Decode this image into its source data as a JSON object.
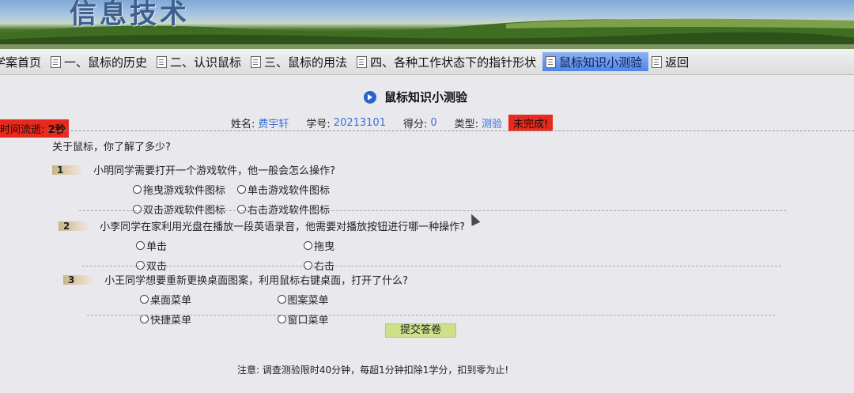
{
  "banner": {
    "title": "信息技术"
  },
  "nav": {
    "items": [
      {
        "label": "学案首页"
      },
      {
        "label": "一、鼠标的历史"
      },
      {
        "label": "二、认识鼠标"
      },
      {
        "label": "三、鼠标的用法"
      },
      {
        "label": "四、各种工作状态下的指针形状"
      },
      {
        "label": "鼠标知识小测验"
      },
      {
        "label": "返回"
      }
    ]
  },
  "quiz": {
    "title": "鼠标知识小测验",
    "name_label": "姓名:",
    "name_value": "费宇轩",
    "id_label": "学号:",
    "id_value": "20213101",
    "score_label": "得分:",
    "score_value": "0",
    "type_label": "类型:",
    "type_value": "测验",
    "status": "未完成!",
    "timer_label": "时间流逝:",
    "timer_value": "2秒",
    "intro": "关于鼠标，你了解了多少?",
    "questions": [
      {
        "num": "1",
        "text": "小明同学需要打开一个游戏软件，他一般会怎么操作?",
        "options": [
          "拖曳游戏软件图标",
          "单击游戏软件图标",
          "双击游戏软件图标",
          "右击游戏软件图标"
        ]
      },
      {
        "num": "2",
        "text": "小李同学在家利用光盘在播放一段英语录音，他需要对播放按钮进行哪一种操作?",
        "options": [
          "单击",
          "拖曳",
          "双击",
          "右击"
        ]
      },
      {
        "num": "3",
        "text": "小王同学想要重新更换桌面图案，利用鼠标右键桌面，打开了什么?",
        "options": [
          "桌面菜单",
          "图案菜单",
          "快捷菜单",
          "窗口菜单"
        ]
      }
    ],
    "submit_label": "提交答卷",
    "note": "注意: 调查测验限时40分钟，每超1分钟扣除1学分，扣到零为止!"
  }
}
